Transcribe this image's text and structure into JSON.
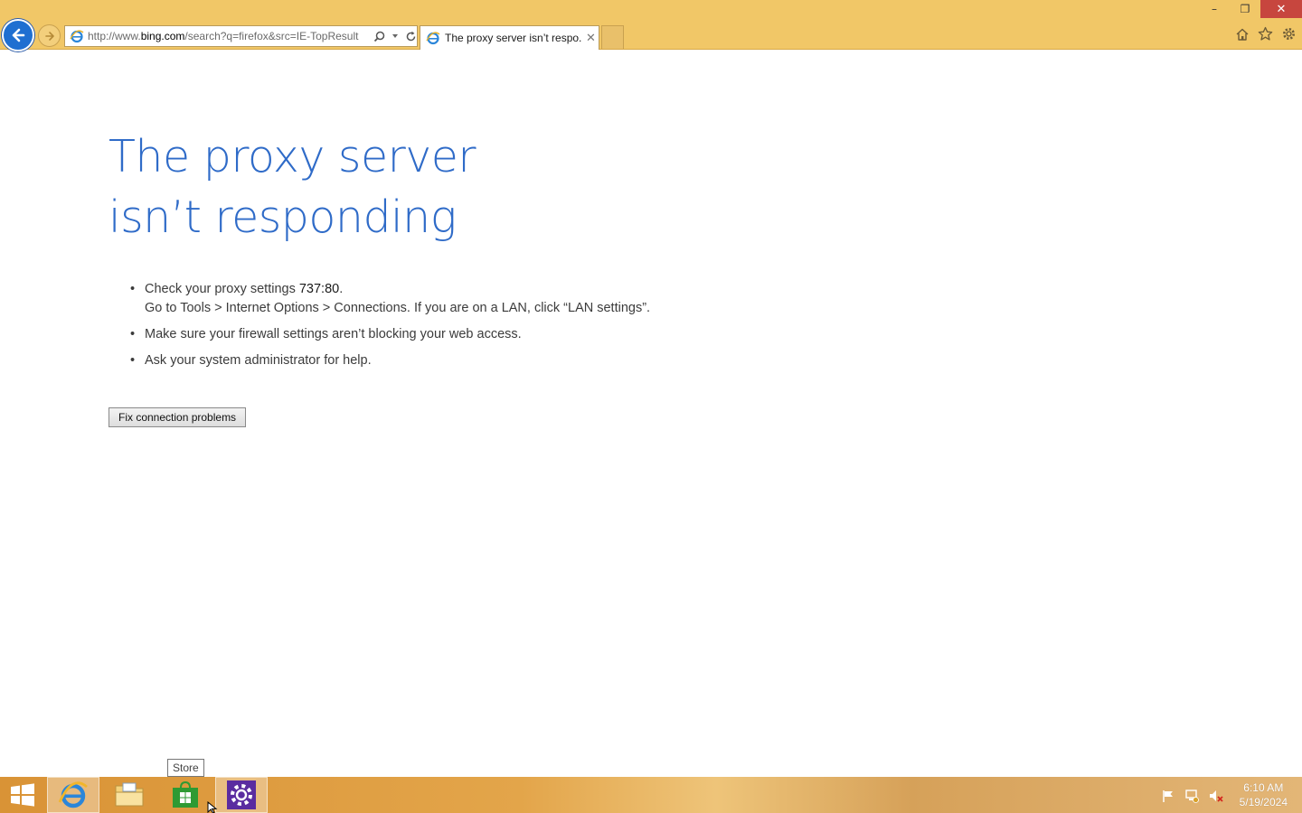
{
  "browser": {
    "address": {
      "prefix": "http://www.",
      "host": "bing.com",
      "path": "/search?q=firefox&src=IE-TopResult"
    },
    "tab": {
      "title": "The proxy server isn’t respo...",
      "close_glyph": "✕"
    },
    "window_controls": {
      "minimize": "–",
      "restore": "❐",
      "close": "✕"
    },
    "tools": [
      "home-icon",
      "favorites-star-icon",
      "settings-gear-icon"
    ],
    "accent_color": "#f1c767"
  },
  "page": {
    "title": "The proxy server isn’t responding",
    "tips": [
      {
        "text": "Check your proxy settings ",
        "value": "737:80",
        "suffix": ".",
        "detail": "Go to Tools > Internet Options > Connections. If you are on a LAN, click “LAN settings”."
      },
      {
        "text": "Make sure your firewall settings aren’t blocking your web access."
      },
      {
        "text": "Ask your system administrator for help."
      }
    ],
    "bullet": "•",
    "fix_button": "Fix connection problems",
    "title_color": "#2f6bc8"
  },
  "taskbar": {
    "items": [
      "start-button",
      "internet-explorer",
      "file-explorer",
      "store",
      "settings"
    ],
    "tooltip": "Store",
    "clock": {
      "time": "6:10 AM",
      "date": "5/19/2024"
    }
  }
}
